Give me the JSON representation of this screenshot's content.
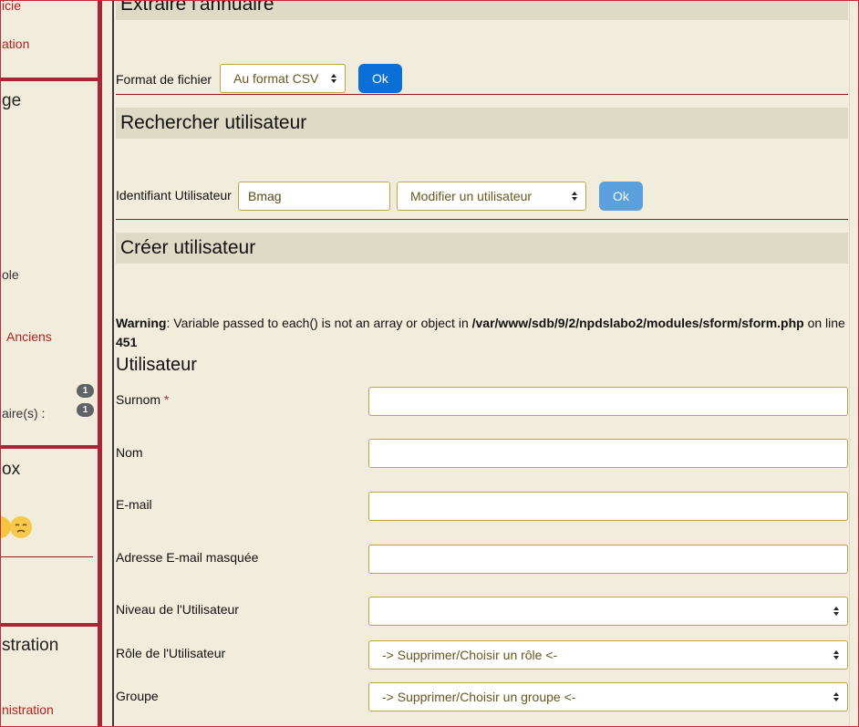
{
  "sidebar": {
    "link1": "icie",
    "link2": "ation",
    "head1": "ge",
    "text_role": "ole",
    "link_anciens": "Anciens",
    "text_aires": "aire(s) :",
    "badge1": "1",
    "badge2": "1",
    "head2": "ox",
    "head3": "stration",
    "link_admin": "nistration"
  },
  "sections": {
    "extract": {
      "title": "Extraire l'annuaire",
      "format_label": "Format de fichier",
      "format_value": "Au format CSV",
      "ok": "Ok"
    },
    "search": {
      "title": "Rechercher utilisateur",
      "id_label": "Identifiant Utilisateur",
      "id_value": "Bmag",
      "action_value": "Modifier un utilisateur",
      "ok": "Ok"
    },
    "create": {
      "title": "Créer utilisateur"
    }
  },
  "warning": {
    "label": "Warning",
    "message": ": Variable passed to each() is not an array or object in ",
    "path": "/var/www/sdb/9/2/npdslabo2/modules/sform/sform.php",
    "on": " on line ",
    "line": "451"
  },
  "form": {
    "heading": "Utilisateur",
    "required_mark": "*",
    "fields": {
      "surnom": "Surnom",
      "nom": "Nom",
      "email": "E-mail",
      "email_masked": "Adresse E-mail masquée",
      "niveau": "Niveau de l'Utilisateur",
      "role": "Rôle de l'Utilisateur",
      "groupe": "Groupe"
    },
    "role_value": "-> Supprimer/Choisir un rôle <-",
    "groupe_value": "-> Supprimer/Choisir un groupe <-"
  },
  "colors": {
    "accent": "#a52637",
    "link": "#b22222",
    "primary_button": "#0a6fd6",
    "section_bg": "#dedac6",
    "page_bg": "#f2ecdc"
  }
}
